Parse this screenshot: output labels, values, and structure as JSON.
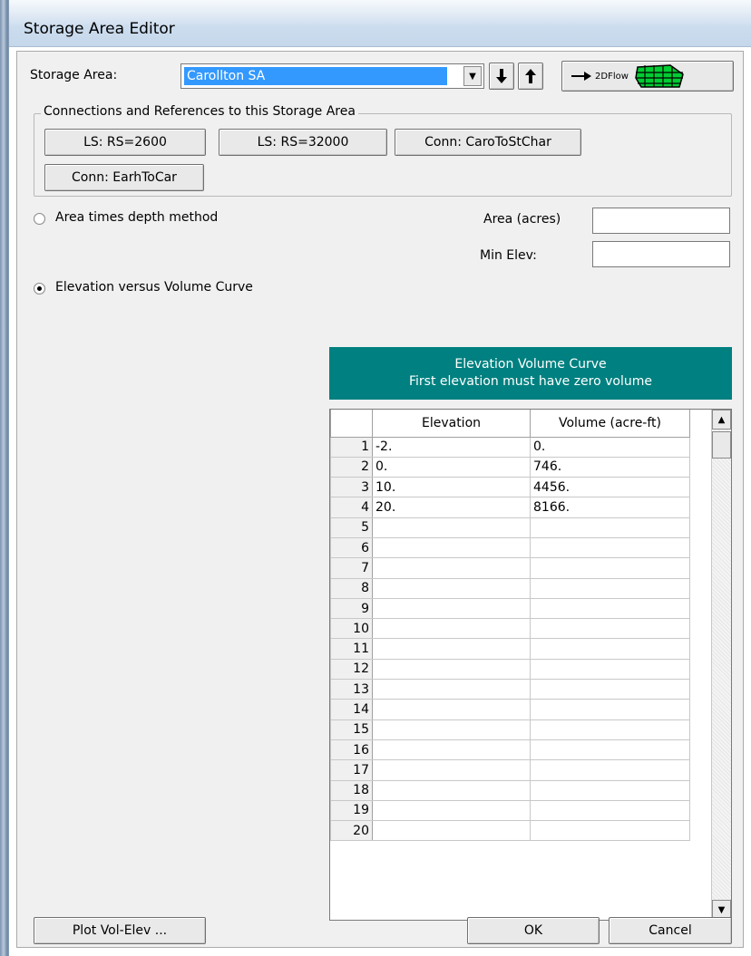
{
  "window": {
    "title": "Storage Area Editor"
  },
  "storage_area": {
    "label": "Storage Area:",
    "selected": "Carollton SA",
    "flow2d_label": "2DFlow"
  },
  "connections": {
    "legend": "Connections and References to this Storage Area",
    "buttons": [
      "LS: RS=2600",
      "LS: RS=32000",
      "Conn: CaroToStChar",
      "Conn: EarhToCar"
    ]
  },
  "method": {
    "area_times_depth": "Area times depth method",
    "elev_vs_volume": "Elevation versus Volume Curve",
    "selected": "elev_vs_volume"
  },
  "fields": {
    "area_label": "Area (acres)",
    "area_value": "",
    "min_elev_label": "Min Elev:",
    "min_elev_value": ""
  },
  "curve": {
    "title": "Elevation Volume Curve",
    "subtitle": "First elevation must have zero volume",
    "columns": [
      "Elevation",
      "Volume (acre-ft)"
    ],
    "rows": [
      {
        "n": "1",
        "elev": "-2.",
        "vol": "0."
      },
      {
        "n": "2",
        "elev": "0.",
        "vol": "746."
      },
      {
        "n": "3",
        "elev": "10.",
        "vol": "4456."
      },
      {
        "n": "4",
        "elev": "20.",
        "vol": "8166."
      },
      {
        "n": "5",
        "elev": "",
        "vol": ""
      },
      {
        "n": "6",
        "elev": "",
        "vol": ""
      },
      {
        "n": "7",
        "elev": "",
        "vol": ""
      },
      {
        "n": "8",
        "elev": "",
        "vol": ""
      },
      {
        "n": "9",
        "elev": "",
        "vol": ""
      },
      {
        "n": "10",
        "elev": "",
        "vol": ""
      },
      {
        "n": "11",
        "elev": "",
        "vol": ""
      },
      {
        "n": "12",
        "elev": "",
        "vol": ""
      },
      {
        "n": "13",
        "elev": "",
        "vol": ""
      },
      {
        "n": "14",
        "elev": "",
        "vol": ""
      },
      {
        "n": "15",
        "elev": "",
        "vol": ""
      },
      {
        "n": "16",
        "elev": "",
        "vol": ""
      },
      {
        "n": "17",
        "elev": "",
        "vol": ""
      },
      {
        "n": "18",
        "elev": "",
        "vol": ""
      },
      {
        "n": "19",
        "elev": "",
        "vol": ""
      },
      {
        "n": "20",
        "elev": "",
        "vol": ""
      }
    ]
  },
  "footer": {
    "plot": "Plot Vol-Elev ...",
    "ok": "OK",
    "cancel": "Cancel"
  },
  "colors": {
    "grid_header_bg": "#008080",
    "selection": "#3399ff"
  }
}
